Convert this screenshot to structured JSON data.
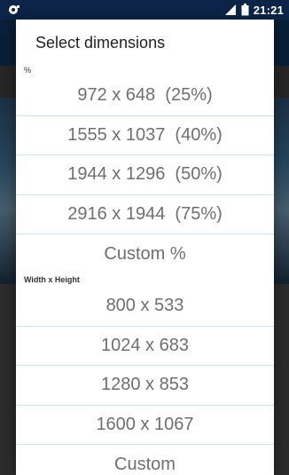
{
  "status_bar": {
    "time": "21:21"
  },
  "dialog": {
    "title": "Select dimensions",
    "percent_section_label": "%",
    "percent_options": [
      "972 x 648  (25%)",
      "1555 x 1037  (40%)",
      "1944 x 1296  (50%)",
      "2916 x 1944  (75%)",
      "Custom %"
    ],
    "wh_section_label": "Width x Height",
    "wh_options": [
      "800 x 533",
      "1024 x 683",
      "1280 x 853",
      "1600 x 1067",
      "Custom"
    ]
  },
  "colors": {
    "status_bar_bg": "#0b2447",
    "app_bar_bg": "#0f2f58",
    "divider": "#cfe3ee",
    "item_text": "#6f6f6f"
  }
}
